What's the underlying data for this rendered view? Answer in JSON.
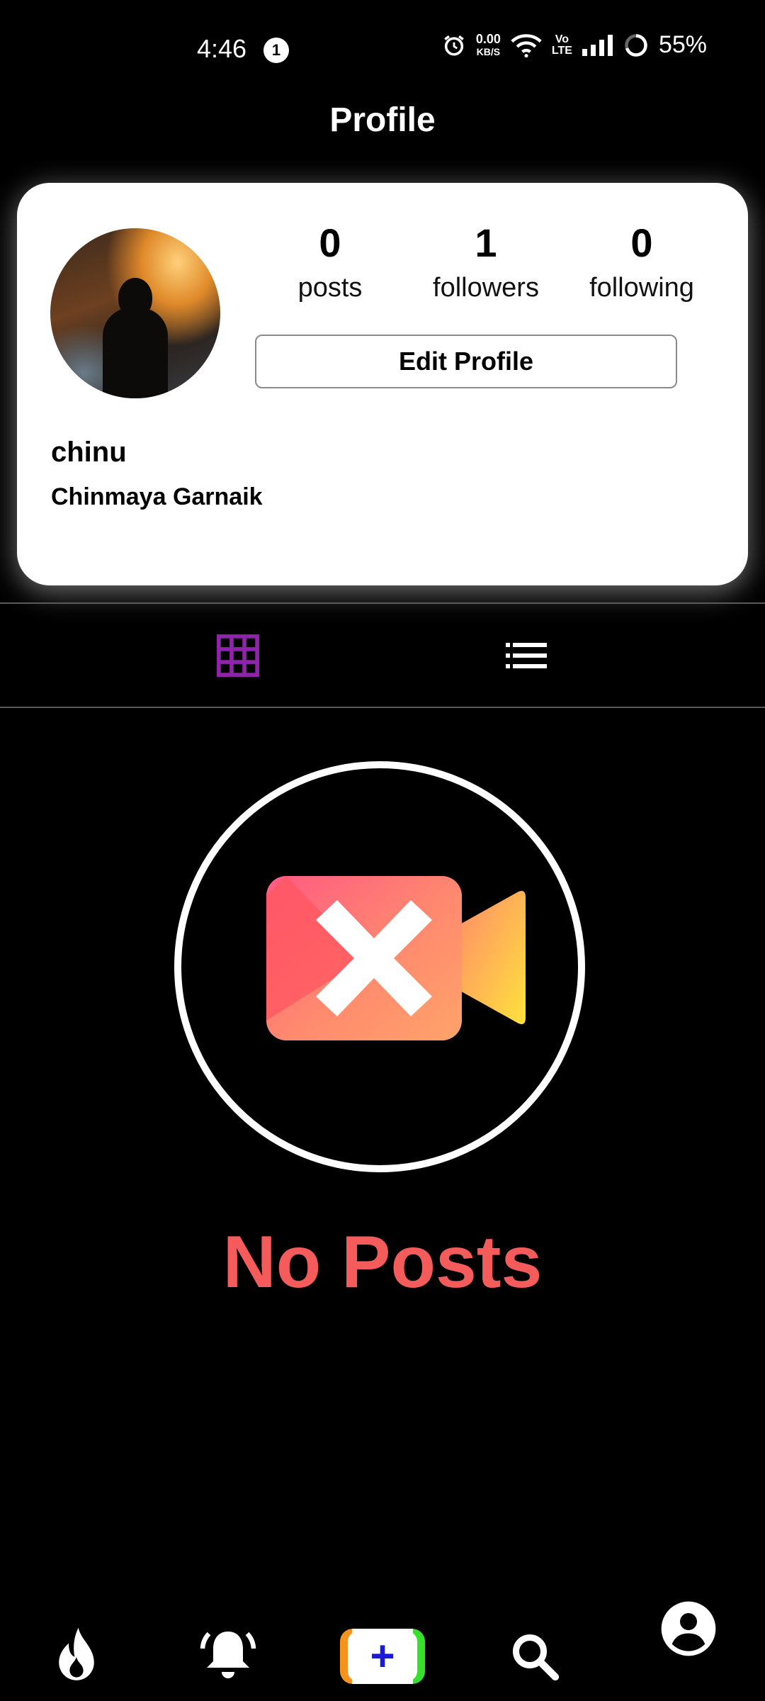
{
  "status_bar": {
    "time": "4:46",
    "notification_count": "1",
    "net_speed_value": "0.00",
    "net_speed_unit": "KB/S",
    "volte_top": "Vo",
    "volte_bottom": "LTE",
    "battery": "55%"
  },
  "header": {
    "title": "Profile"
  },
  "profile": {
    "stats": [
      {
        "count": "0",
        "label": "posts"
      },
      {
        "count": "1",
        "label": "followers"
      },
      {
        "count": "0",
        "label": "following"
      }
    ],
    "edit_label": "Edit Profile",
    "username": "chinu",
    "full_name": "Chinmaya Garnaik"
  },
  "tabs": [
    {
      "icon": "grid-icon",
      "active": true,
      "color": "#8e24aa"
    },
    {
      "icon": "list-icon",
      "active": false,
      "color": "#ffffff"
    }
  ],
  "empty_state": {
    "message": "No Posts",
    "icon": "video-off-icon",
    "color": "#f45b5b"
  },
  "bottom_nav": [
    {
      "icon": "flame-icon"
    },
    {
      "icon": "bell-icon"
    },
    {
      "icon": "add-icon"
    },
    {
      "icon": "search-icon"
    },
    {
      "icon": "profile-icon"
    }
  ]
}
